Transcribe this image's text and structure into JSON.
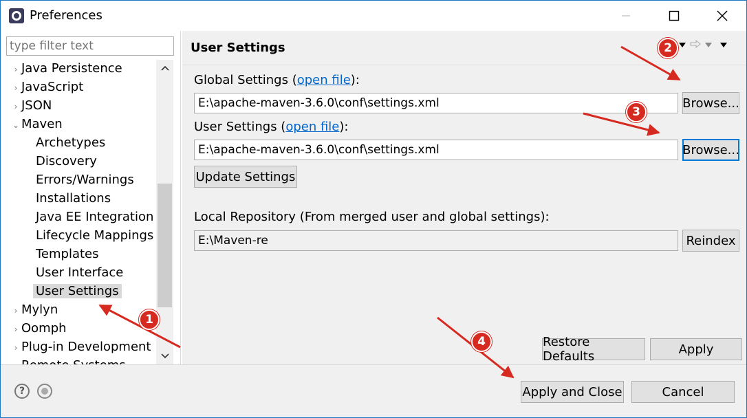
{
  "window": {
    "title": "Preferences"
  },
  "filter": {
    "placeholder": "type filter text"
  },
  "tree": {
    "items": [
      {
        "label": "Java Persistence",
        "expander": "›"
      },
      {
        "label": "JavaScript",
        "expander": "›"
      },
      {
        "label": "JSON",
        "expander": "›"
      },
      {
        "label": "Maven",
        "expander": "⌄"
      },
      {
        "label": "Archetypes"
      },
      {
        "label": "Discovery"
      },
      {
        "label": "Errors/Warnings"
      },
      {
        "label": "Installations"
      },
      {
        "label": "Java EE Integration"
      },
      {
        "label": "Lifecycle Mappings"
      },
      {
        "label": "Templates"
      },
      {
        "label": "User Interface"
      },
      {
        "label": "User Settings"
      },
      {
        "label": "Mylyn",
        "expander": "›"
      },
      {
        "label": "Oomph",
        "expander": "›"
      },
      {
        "label": "Plug-in Development",
        "expander": "›"
      },
      {
        "label": "Remote Systems",
        "expander": "›"
      }
    ]
  },
  "page": {
    "title": "User Settings",
    "global_label_prefix": "Global Settings (",
    "global_link": "open file",
    "global_label_suffix": "):",
    "global_value": "E:\\apache-maven-3.6.0\\conf\\settings.xml",
    "browse_label": "Browse...",
    "user_label_prefix": "User Settings (",
    "user_link": "open file",
    "user_label_suffix": "):",
    "user_value": "E:\\apache-maven-3.6.0\\conf\\settings.xml",
    "update_label": "Update Settings",
    "local_repo_label": "Local Repository (From merged user and global settings):",
    "local_repo_value": "E:\\Maven-re",
    "reindex_label": "Reindex",
    "restore_label": "Restore Defaults",
    "apply_label": "Apply"
  },
  "footer": {
    "apply_close_label": "Apply and Close",
    "cancel_label": "Cancel"
  },
  "annotations": {
    "badges": [
      "1",
      "2",
      "3",
      "4"
    ],
    "color": "#d62a21"
  }
}
